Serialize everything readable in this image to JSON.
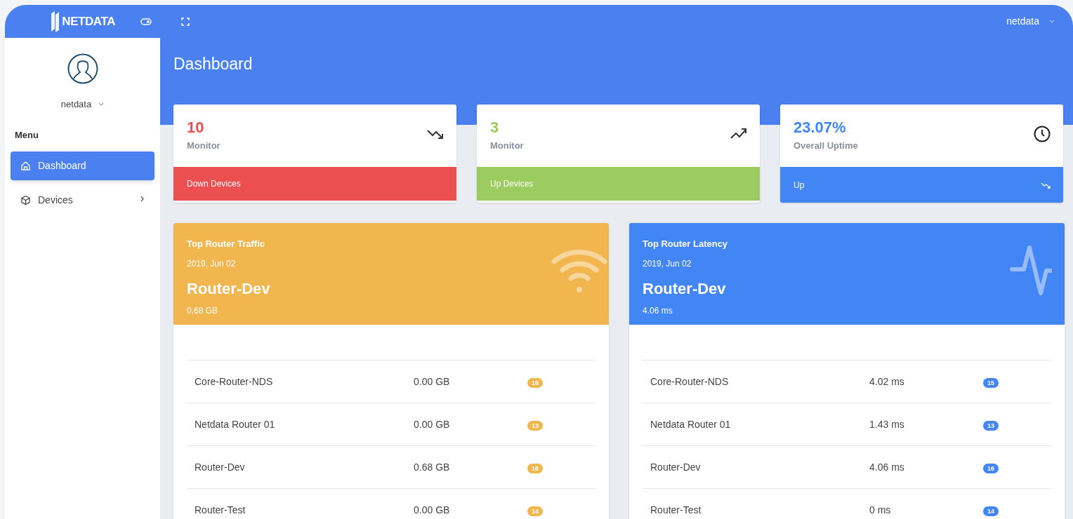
{
  "topbar": {
    "logo": "NETDATA",
    "user": "netdata"
  },
  "sidebar": {
    "user": "netdata",
    "menu_title": "Menu",
    "items": [
      {
        "label": "Dashboard",
        "kind": "home",
        "selected": true,
        "has_children": false
      },
      {
        "label": "Devices",
        "kind": "box",
        "selected": false,
        "has_children": true
      }
    ]
  },
  "page_title": "Dashboard",
  "stats": [
    {
      "kind": "down",
      "value": "10",
      "label": "Monitor",
      "footer": "Down Devices",
      "color": "#eb4f4f"
    },
    {
      "kind": "up",
      "value": "3",
      "label": "Monitor",
      "footer": "Up Devices",
      "color": "#9ccb5f"
    },
    {
      "kind": "uptime",
      "value": "23.07%",
      "label": "Overall Uptime",
      "footer": "Up",
      "color": "#4285f4"
    }
  ],
  "panels": [
    {
      "kind": "traffic",
      "title": "Top Router Traffic",
      "date": "2019, Jun 02",
      "device": "Router-Dev",
      "reading": "0.68 GB",
      "color": "#f2b64f",
      "rows": [
        {
          "name": "Core-Router-NDS",
          "value": "0.00 GB",
          "count": "15"
        },
        {
          "name": "Netdata Router 01",
          "value": "0.00 GB",
          "count": "13"
        },
        {
          "name": "Router-Dev",
          "value": "0.68 GB",
          "count": "16"
        },
        {
          "name": "Router-Test",
          "value": "0.00 GB",
          "count": "14"
        }
      ]
    },
    {
      "kind": "latency",
      "title": "Top Router Latency",
      "date": "2019, Jun 02",
      "device": "Router-Dev",
      "reading": "4.06 ms",
      "color": "#4285f4",
      "rows": [
        {
          "name": "Core-Router-NDS",
          "value": "4.02 ms",
          "count": "15"
        },
        {
          "name": "Netdata Router 01",
          "value": "1.43 ms",
          "count": "13"
        },
        {
          "name": "Router-Dev",
          "value": "4.06 ms",
          "count": "16"
        },
        {
          "name": "Router-Test",
          "value": "0 ms",
          "count": "14"
        }
      ]
    }
  ]
}
